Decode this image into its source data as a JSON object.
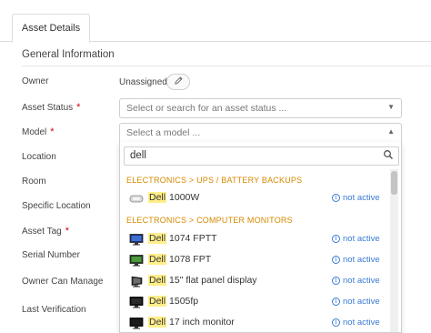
{
  "tabs": [
    {
      "label": "Asset Details"
    }
  ],
  "section_title": "General Information",
  "labels": {
    "owner": "Owner",
    "asset_status": "Asset Status",
    "model": "Model",
    "location": "Location",
    "room": "Room",
    "specific_location": "Specific Location",
    "asset_tag": "Asset Tag",
    "serial_number": "Serial Number",
    "owner_can_manage": "Owner Can Manage",
    "last_verification": "Last Verification"
  },
  "required_marker": "*",
  "owner_value": "Unassigned",
  "asset_status_select": {
    "placeholder": "Select or search for an asset status ..."
  },
  "model_select": {
    "placeholder": "Select a model ..."
  },
  "search": {
    "value": "dell"
  },
  "groups": [
    {
      "title": "ELECTRONICS > UPS / BATTERY BACKUPS",
      "items": [
        {
          "match": "Dell",
          "rest": " 1000W",
          "status": "not active",
          "icon": "ups-icon"
        }
      ]
    },
    {
      "title": "ELECTRONICS > COMPUTER MONITORS",
      "items": [
        {
          "match": "Dell",
          "rest": " 1074 FPTT",
          "status": "not active",
          "icon": "monitor-icon"
        },
        {
          "match": "Dell",
          "rest": " 1078 FPT",
          "status": "not active",
          "icon": "monitor-icon"
        },
        {
          "match": "Dell",
          "rest": " 15\" flat panel display",
          "status": "not active",
          "icon": "monitor-icon"
        },
        {
          "match": "Dell",
          "rest": " 1505fp",
          "status": "not active",
          "icon": "monitor-icon"
        },
        {
          "match": "Dell",
          "rest": " 17 inch monitor",
          "status": "not active",
          "icon": "monitor-icon"
        }
      ]
    }
  ],
  "colors": {
    "accent_link": "#3a7bd5",
    "group_header": "#d68a00",
    "highlight": "#ffee8a",
    "required": "#d0021b"
  }
}
